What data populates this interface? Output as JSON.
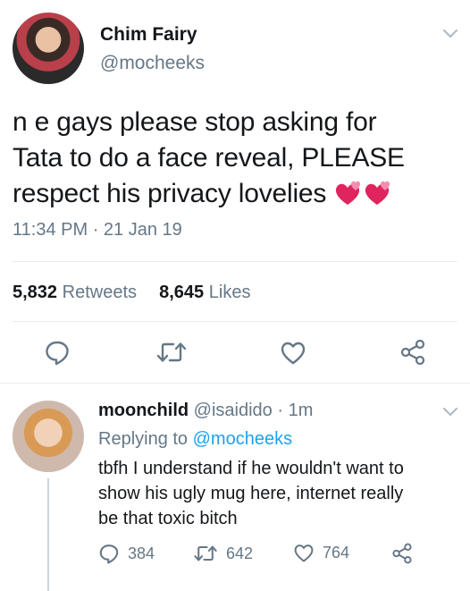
{
  "tweet": {
    "author_name": "Chim Fairy",
    "author_handle": "@mocheeks",
    "text_line1": "n e gays please stop asking for",
    "text_line2": "Tata to do a face reveal, PLEASE",
    "text_line3": "respect his privacy lovelies",
    "time": "11:34 PM",
    "date": "21 Jan 19",
    "retweets_count": "5,832",
    "retweets_label": "Retweets",
    "likes_count": "8,645",
    "likes_label": "Likes"
  },
  "reply": {
    "author_name": "moonchild",
    "author_handle": "@isaidido",
    "age": "1m",
    "replying_label": "Replying to",
    "replying_handle": "@mocheeks",
    "text_line1": "tbfh I understand if he wouldn't want to",
    "text_line2": "show his ugly mug here, internet really",
    "text_line3": "be that toxic bitch",
    "replies_count": "384",
    "retweets_count": "642",
    "likes_count": "764"
  },
  "colors": {
    "text": "#14171a",
    "secondary": "#657786",
    "link": "#1da1f2",
    "divider": "#e6ecf0",
    "heart": "#e0245e"
  },
  "icons": [
    "chevron-down-icon",
    "reply-icon",
    "retweet-icon",
    "like-icon",
    "share-icon",
    "two-hearts-emoji"
  ]
}
